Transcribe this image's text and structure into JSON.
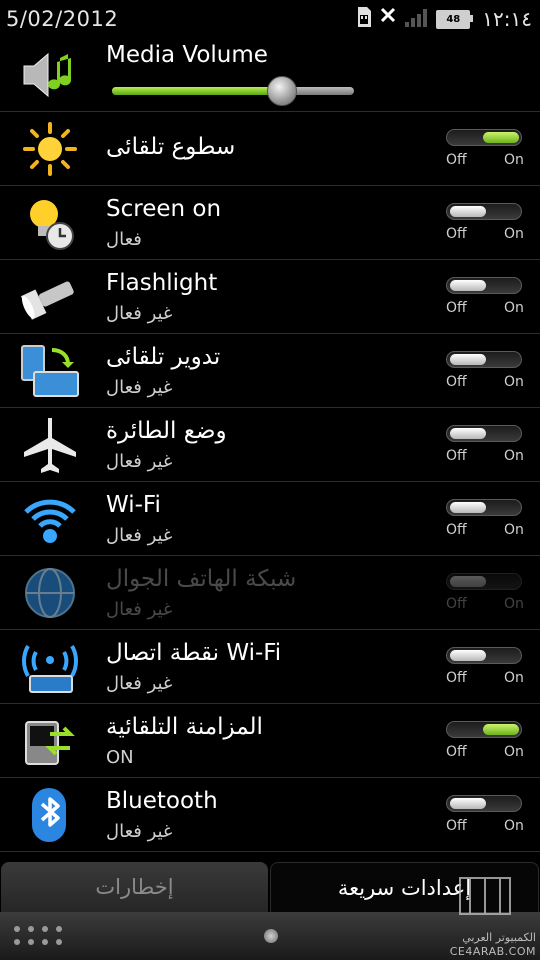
{
  "status_bar": {
    "date": "5/02/2012",
    "time": "١٢:١٤",
    "battery": "48",
    "icons": [
      "sd-card-icon",
      "no-sim-icon",
      "signal-icon",
      "battery-icon"
    ]
  },
  "media": {
    "title": "Media Volume",
    "volume_fraction": 0.7,
    "icon": "speaker-music-icon"
  },
  "toggle_labels": {
    "off": "Off",
    "on": "On"
  },
  "settings": [
    {
      "title": "سطوع تلقائى",
      "subtitle": "",
      "on": true,
      "enabled": true,
      "icon": "sun-icon"
    },
    {
      "title": "Screen on",
      "subtitle": "فعال",
      "on": false,
      "enabled": true,
      "icon": "bulb-clock-icon"
    },
    {
      "title": "Flashlight",
      "subtitle": "غير فعال",
      "on": false,
      "enabled": true,
      "icon": "flashlight-icon"
    },
    {
      "title": "تدوير تلقائى",
      "subtitle": "غير فعال",
      "on": false,
      "enabled": true,
      "icon": "rotate-icon"
    },
    {
      "title": "وضع الطائرة",
      "subtitle": "غير فعال",
      "on": false,
      "enabled": true,
      "icon": "airplane-icon"
    },
    {
      "title": "Wi-Fi",
      "subtitle": "غير فعال",
      "on": false,
      "enabled": true,
      "icon": "wifi-icon"
    },
    {
      "title": "شبكة الهاتف الجوال",
      "subtitle": "غير فعال",
      "on": false,
      "enabled": false,
      "icon": "globe-icon"
    },
    {
      "title": "نقطة اتصال Wi-Fi",
      "subtitle": "غير فعال",
      "on": false,
      "enabled": true,
      "icon": "hotspot-icon"
    },
    {
      "title": "المزامنة التلقائية",
      "subtitle": "ON",
      "on": true,
      "enabled": true,
      "icon": "sync-icon"
    },
    {
      "title": "Bluetooth",
      "subtitle": "غير فعال",
      "on": false,
      "enabled": true,
      "icon": "bluetooth-icon"
    }
  ],
  "tabs": [
    {
      "label": "إخطارات",
      "active": false
    },
    {
      "label": "إعدادات سريعة",
      "active": true
    }
  ],
  "watermark": {
    "line1": "الكمبيوتر العربي",
    "line2": "CE4ARAB.COM"
  },
  "colors": {
    "accent_green": "#7fd021",
    "background": "#000000"
  }
}
